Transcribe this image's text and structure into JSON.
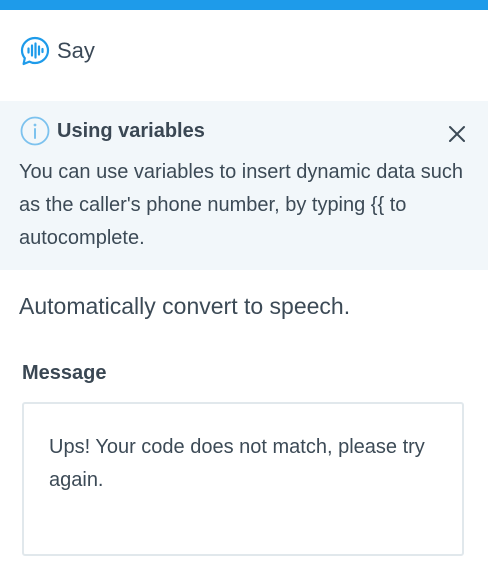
{
  "header": {
    "title": "Say",
    "icon": "voice-chat-icon",
    "accent_color": "#1e9bea"
  },
  "info": {
    "icon": "info-icon",
    "title": "Using variables",
    "body": "You can use variables to insert dynamic data such as the caller's phone number, by typing {{ to autocomplete.",
    "close_icon": "close-icon"
  },
  "subtitle": "Automatically convert to speech.",
  "message": {
    "label": "Message",
    "value": "Ups! Your code does not match, please try again."
  }
}
